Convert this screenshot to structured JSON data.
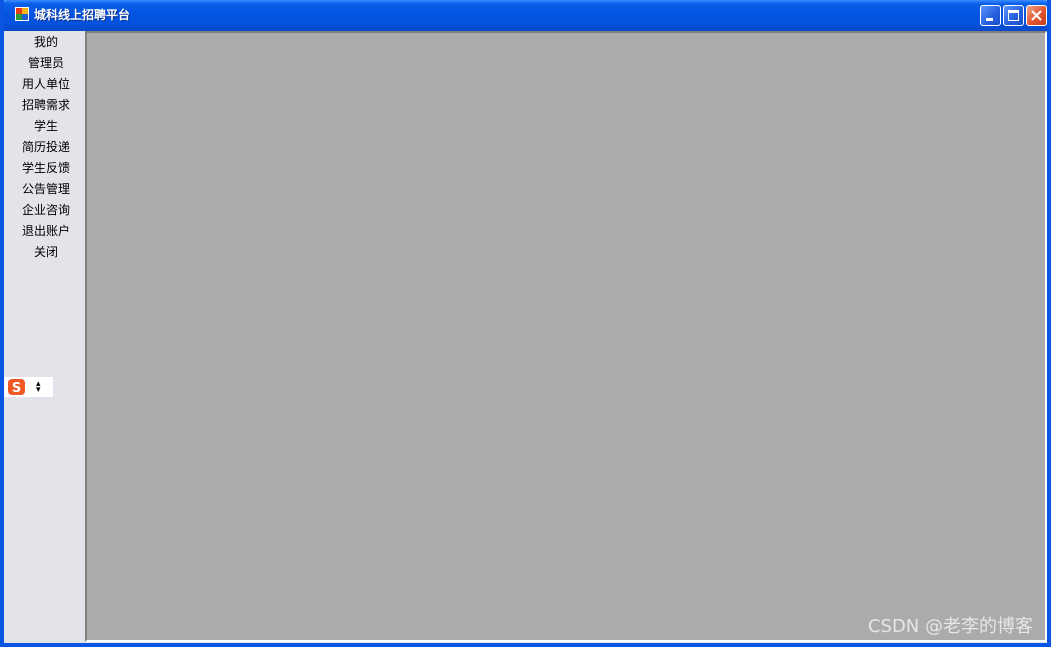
{
  "window": {
    "title": "城科线上招聘平台"
  },
  "sidebar": {
    "items": [
      {
        "label": "我的"
      },
      {
        "label": "管理员"
      },
      {
        "label": "用人单位"
      },
      {
        "label": "招聘需求"
      },
      {
        "label": "学生"
      },
      {
        "label": "简历投递"
      },
      {
        "label": "学生反馈"
      },
      {
        "label": "公告管理"
      },
      {
        "label": "企业咨询"
      },
      {
        "label": "退出账户"
      },
      {
        "label": "关闭"
      }
    ]
  },
  "ime": {
    "logo_letter": "S",
    "icon": "sogou-ime-icon"
  },
  "watermark": {
    "text": "CSDN @老李的博客"
  },
  "colors": {
    "titlebar": "#0454e2",
    "frame": "#0b55e3",
    "sidebar_bg": "#e4e3ea",
    "mdi_bg": "#ababab",
    "close_button": "#e2552f",
    "ime_orange": "#f05a22"
  }
}
